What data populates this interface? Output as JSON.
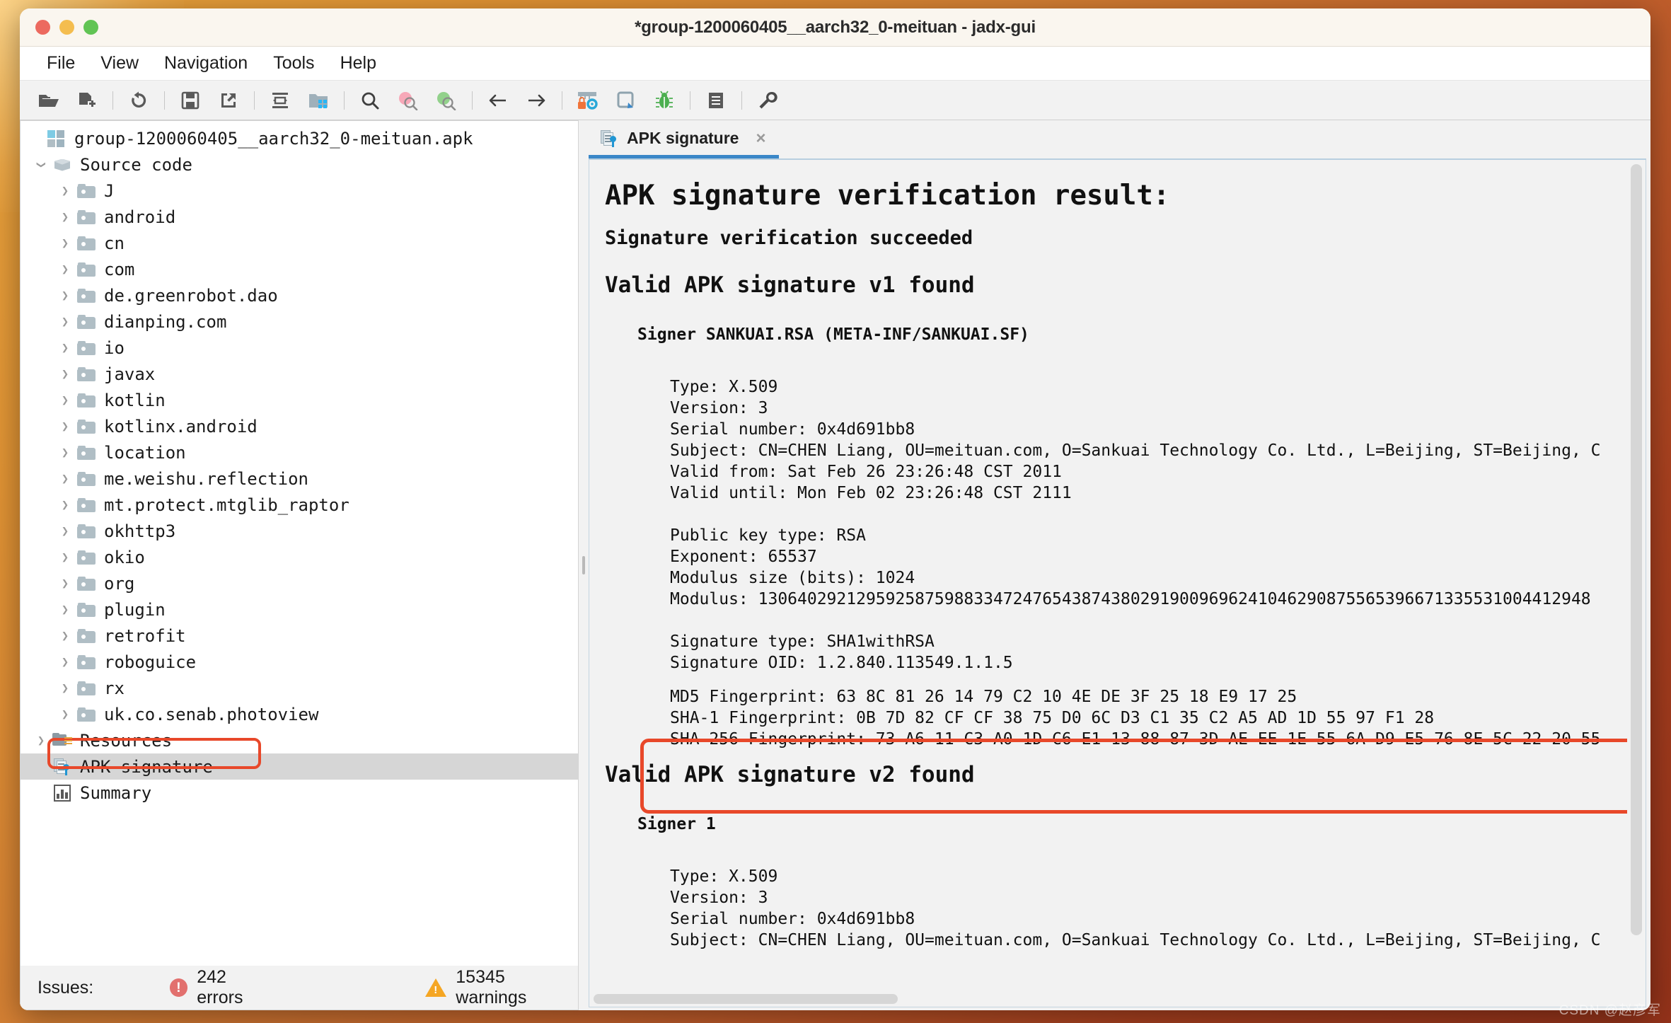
{
  "window": {
    "title": "*group-1200060405__aarch32_0-meituan - jadx-gui",
    "traffic": {
      "close": "close-button",
      "minimize": "minimize-button",
      "zoom": "zoom-button"
    }
  },
  "menubar": {
    "items": [
      "File",
      "View",
      "Navigation",
      "Tools",
      "Help"
    ]
  },
  "toolbar": {
    "buttons": [
      {
        "name": "open-file-icon",
        "glyph": "folder-open"
      },
      {
        "name": "add-files-icon",
        "glyph": "add-files"
      },
      {
        "name": "reload-icon",
        "glyph": "reload"
      },
      {
        "name": "save-all-icon",
        "glyph": "save"
      },
      {
        "name": "export-gradle-icon",
        "glyph": "export"
      },
      {
        "name": "expand-collapse-icon",
        "glyph": "collapse"
      },
      {
        "name": "open-project-icon",
        "glyph": "project"
      },
      {
        "name": "search-icon",
        "glyph": "search"
      },
      {
        "name": "search-text-icon",
        "glyph": "search-pink"
      },
      {
        "name": "search-resource-icon",
        "glyph": "search-green"
      },
      {
        "name": "back-icon",
        "glyph": "arrow-left"
      },
      {
        "name": "forward-icon",
        "glyph": "arrow-right"
      },
      {
        "name": "deobfuscation-icon",
        "glyph": "lock-gear"
      },
      {
        "name": "quark-icon",
        "glyph": "quark"
      },
      {
        "name": "debugger-icon",
        "glyph": "bug"
      },
      {
        "name": "logs-icon",
        "glyph": "logs"
      },
      {
        "name": "preferences-icon",
        "glyph": "wrench"
      }
    ]
  },
  "tree": {
    "root": {
      "label": "group-1200060405__aarch32_0-meituan.apk",
      "icon": "apk-package-icon"
    },
    "nodes": [
      {
        "label": "Source code",
        "icon": "box-icon",
        "indent": 0,
        "twisty": "down"
      },
      {
        "label": "J",
        "icon": "folder-icon",
        "indent": 1,
        "twisty": "right"
      },
      {
        "label": "android",
        "icon": "folder-icon",
        "indent": 1,
        "twisty": "right"
      },
      {
        "label": "cn",
        "icon": "folder-icon",
        "indent": 1,
        "twisty": "right"
      },
      {
        "label": "com",
        "icon": "folder-icon",
        "indent": 1,
        "twisty": "right"
      },
      {
        "label": "de.greenrobot.dao",
        "icon": "folder-icon",
        "indent": 1,
        "twisty": "right"
      },
      {
        "label": "dianping.com",
        "icon": "folder-icon",
        "indent": 1,
        "twisty": "right"
      },
      {
        "label": "io",
        "icon": "folder-icon",
        "indent": 1,
        "twisty": "right"
      },
      {
        "label": "javax",
        "icon": "folder-icon",
        "indent": 1,
        "twisty": "right"
      },
      {
        "label": "kotlin",
        "icon": "folder-icon",
        "indent": 1,
        "twisty": "right"
      },
      {
        "label": "kotlinx.android",
        "icon": "folder-icon",
        "indent": 1,
        "twisty": "right"
      },
      {
        "label": "location",
        "icon": "folder-icon",
        "indent": 1,
        "twisty": "right"
      },
      {
        "label": "me.weishu.reflection",
        "icon": "folder-icon",
        "indent": 1,
        "twisty": "right"
      },
      {
        "label": "mt.protect.mtglib_raptor",
        "icon": "folder-icon",
        "indent": 1,
        "twisty": "right"
      },
      {
        "label": "okhttp3",
        "icon": "folder-icon",
        "indent": 1,
        "twisty": "right"
      },
      {
        "label": "okio",
        "icon": "folder-icon",
        "indent": 1,
        "twisty": "right"
      },
      {
        "label": "org",
        "icon": "folder-icon",
        "indent": 1,
        "twisty": "right"
      },
      {
        "label": "plugin",
        "icon": "folder-icon",
        "indent": 1,
        "twisty": "right"
      },
      {
        "label": "retrofit",
        "icon": "folder-icon",
        "indent": 1,
        "twisty": "right"
      },
      {
        "label": "roboguice",
        "icon": "folder-icon",
        "indent": 1,
        "twisty": "right"
      },
      {
        "label": "rx",
        "icon": "folder-icon",
        "indent": 1,
        "twisty": "right"
      },
      {
        "label": "uk.co.senab.photoview",
        "icon": "folder-icon",
        "indent": 1,
        "twisty": "right"
      },
      {
        "label": "Resources",
        "icon": "resources-folder-icon",
        "indent": 0,
        "twisty": "right"
      },
      {
        "label": "APK signature",
        "icon": "apk-signature-icon",
        "indent": 0,
        "twisty": "none",
        "selected": true,
        "highlighted": true
      },
      {
        "label": "Summary",
        "icon": "summary-icon",
        "indent": 0,
        "twisty": "none"
      }
    ]
  },
  "statusbar": {
    "issues_label": "Issues:",
    "errors": "242 errors",
    "warnings": "15345 warnings"
  },
  "editor": {
    "tab": {
      "label": "APK signature",
      "icon": "apk-signature-icon",
      "close": "×"
    },
    "title": "APK signature verification result:",
    "verification_status": "Signature verification succeeded",
    "v1_heading": "Valid APK signature v1 found",
    "v1_signer": "Signer SANKUAI.RSA (META-INF/SANKUAI.SF)",
    "v1_details": [
      "Type: X.509",
      "Version: 3",
      "Serial number: 0x4d691bb8",
      "Subject: CN=CHEN Liang, OU=meituan.com, O=Sankuai Technology Co. Ltd., L=Beijing, ST=Beijing, C",
      "Valid from: Sat Feb 26 23:26:48 CST 2011",
      "Valid until: Mon Feb 02 23:26:48 CST 2111"
    ],
    "v1_key": [
      "Public key type: RSA",
      "Exponent: 65537",
      "Modulus size (bits): 1024",
      "Modulus: 1306402921295925875988334724765438743802919009696241046290875565396671335531004412948"
    ],
    "v1_sig": [
      "Signature type: SHA1withRSA",
      "Signature OID: 1.2.840.113549.1.1.5"
    ],
    "fingerprints": [
      "MD5 Fingerprint: 63 8C 81 26 14 79 C2 10 4E DE 3F 25 18 E9 17 25",
      "SHA-1 Fingerprint: 0B 7D 82 CF CF 38 75 D0 6C D3 C1 35 C2 A5 AD 1D 55 97 F1 28",
      "SHA-256 Fingerprint: 73 A6 11 C3 A0 1D C6 E1 13 88 87 3D AE EE 1E 55 6A D9 E5 76 8E 5C 22 20 55"
    ],
    "v2_heading": "Valid APK signature v2 found",
    "v2_signer": "Signer 1",
    "v2_details": [
      "Type: X.509",
      "Version: 3",
      "Serial number: 0x4d691bb8",
      "Subject: CN=CHEN Liang, OU=meituan.com, O=Sankuai Technology Co. Ltd., L=Beijing, ST=Beijing, C"
    ]
  },
  "watermark": "CSDN @赵彦军",
  "colors": {
    "accent": "#3a87c8",
    "highlight": "#e8482a",
    "error": "#e2706e",
    "warning": "#f5a623",
    "selection": "#d6d6d6"
  }
}
